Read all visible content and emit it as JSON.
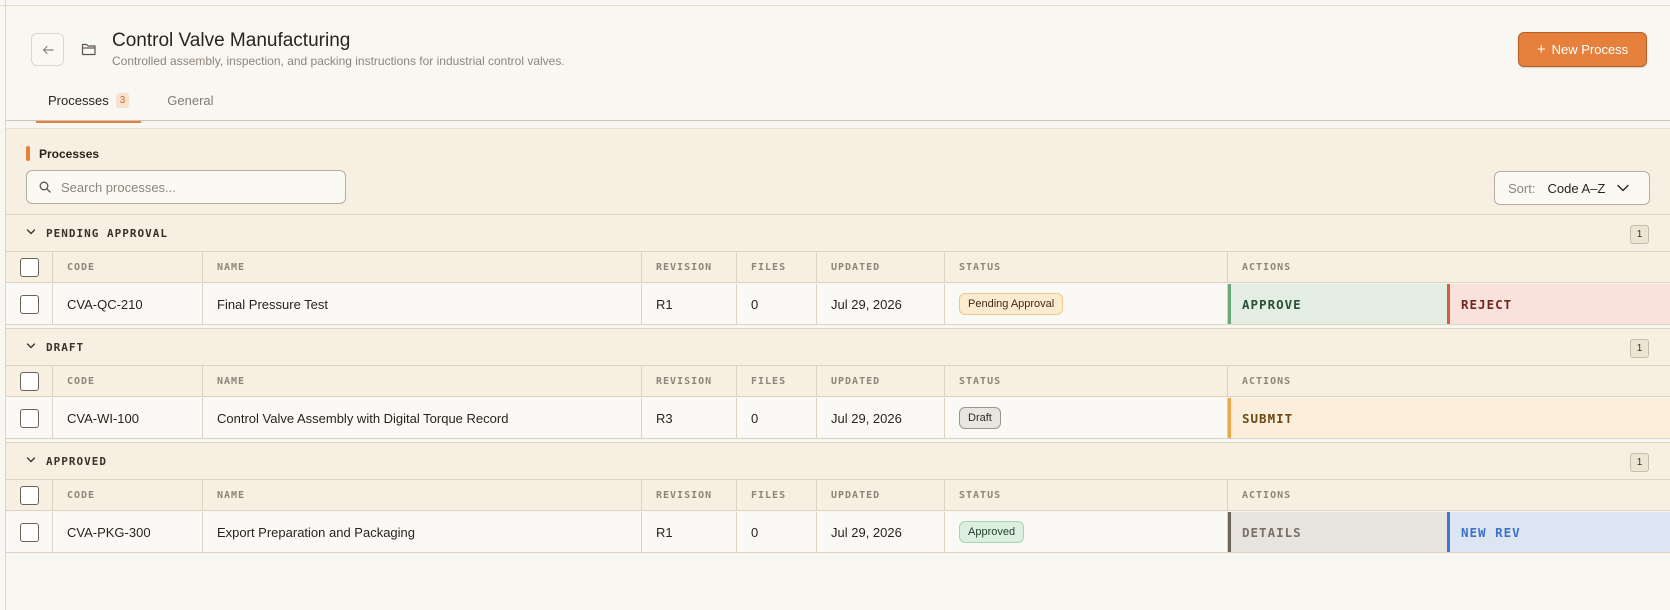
{
  "header": {
    "title": "Control Valve Manufacturing",
    "subtitle": "Controlled assembly, inspection, and packing instructions for industrial control valves.",
    "new_button": "New Process"
  },
  "tabs": [
    {
      "label": "Processes",
      "count": "3",
      "active": true
    },
    {
      "label": "General",
      "active": false
    }
  ],
  "panel": {
    "label": "Processes",
    "search_placeholder": "Search processes...",
    "sort_label": "Sort:",
    "sort_value": "Code A–Z"
  },
  "columns": {
    "code": "CODE",
    "name": "NAME",
    "revision": "REVISION",
    "files": "FILES",
    "updated": "UPDATED",
    "status": "STATUS",
    "actions": "ACTIONS"
  },
  "groups": [
    {
      "title": "PENDING APPROVAL",
      "count": "1",
      "row": {
        "code": "CVA-QC-210",
        "name": "Final Pressure Test",
        "revision": "R1",
        "files": "0",
        "updated": "Jul 29, 2026",
        "status": "Pending Approval"
      },
      "actions": [
        "APPROVE",
        "REJECT"
      ]
    },
    {
      "title": "DRAFT",
      "count": "1",
      "row": {
        "code": "CVA-WI-100",
        "name": "Control Valve Assembly with Digital Torque Record",
        "revision": "R3",
        "files": "0",
        "updated": "Jul 29, 2026",
        "status": "Draft"
      },
      "actions": [
        "SUBMIT"
      ]
    },
    {
      "title": "APPROVED",
      "count": "1",
      "row": {
        "code": "CVA-PKG-300",
        "name": "Export Preparation and Packaging",
        "revision": "R1",
        "files": "0",
        "updated": "Jul 29, 2026",
        "status": "Approved"
      },
      "actions": [
        "DETAILS",
        "NEW REV"
      ]
    }
  ],
  "colors": {
    "accent": "#e5803d",
    "approve": "#6aa77a",
    "reject": "#d65a45",
    "submit": "#e8a94a",
    "new_rev": "#3c78d8"
  },
  "icons": [
    "back-arrow-icon",
    "folder-icon",
    "plus-icon",
    "search-icon",
    "chevron-down-icon"
  ]
}
